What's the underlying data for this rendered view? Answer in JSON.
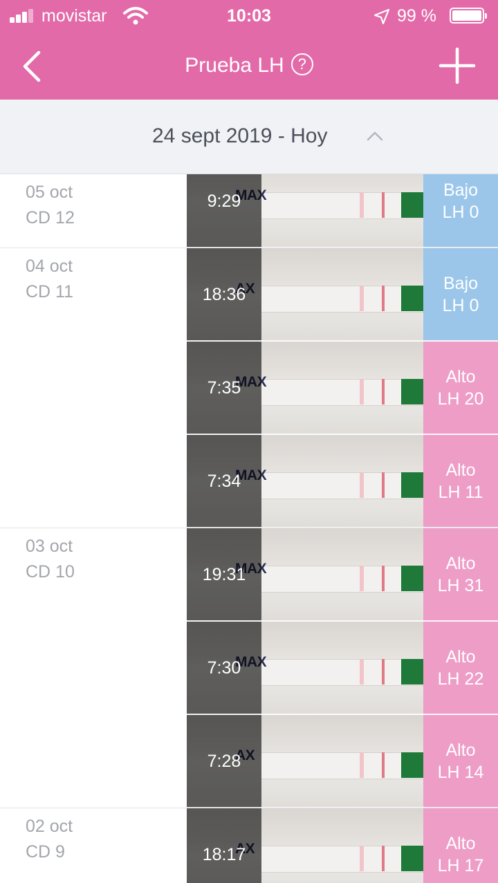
{
  "status_bar": {
    "carrier": "movistar",
    "time": "10:03",
    "battery": "99 %"
  },
  "nav": {
    "title": "Prueba LH",
    "help_glyph": "?"
  },
  "range": {
    "label": "24 sept 2019 - Hoy"
  },
  "colors": {
    "brand_pink": "#e36aa8",
    "low_blue": "#9bc6ea",
    "high_pink": "#ee9dc7"
  },
  "days": [
    {
      "date": "05 oct",
      "cd": "CD 12",
      "tests": [
        {
          "time": "9:29",
          "level": "Bajo",
          "lh": "LH 0",
          "strip_label": "MAX"
        }
      ]
    },
    {
      "date": "04 oct",
      "cd": "CD 11",
      "tests": [
        {
          "time": "18:36",
          "level": "Bajo",
          "lh": "LH 0",
          "strip_label": "AX"
        },
        {
          "time": "7:35",
          "level": "Alto",
          "lh": "LH 20",
          "strip_label": "MAX"
        },
        {
          "time": "7:34",
          "level": "Alto",
          "lh": "LH 11",
          "strip_label": "MAX"
        }
      ]
    },
    {
      "date": "03 oct",
      "cd": "CD 10",
      "tests": [
        {
          "time": "19:31",
          "level": "Alto",
          "lh": "LH 31",
          "strip_label": "MAX"
        },
        {
          "time": "7:30",
          "level": "Alto",
          "lh": "LH 22",
          "strip_label": "MAX"
        },
        {
          "time": "7:28",
          "level": "Alto",
          "lh": "LH 14",
          "strip_label": "AX"
        }
      ]
    },
    {
      "date": "02 oct",
      "cd": "CD 9",
      "tests": [
        {
          "time": "18:17",
          "level": "Alto",
          "lh": "LH 17",
          "strip_label": "AX"
        }
      ]
    }
  ]
}
